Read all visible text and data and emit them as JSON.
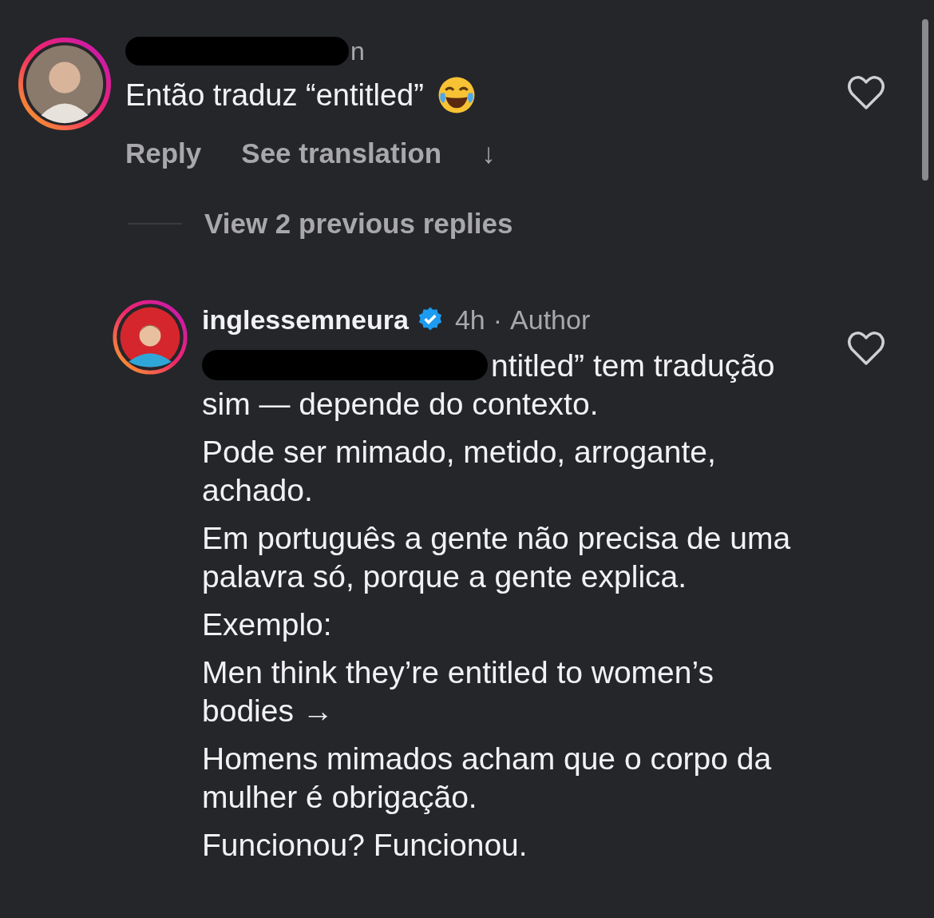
{
  "comment": {
    "username": "n",
    "redacted_username": true,
    "text": "Então traduz “entitled”",
    "liked": false,
    "actions": [
      "Reply",
      "See translation",
      "↓"
    ]
  },
  "view_replies": "View 2 previous replies",
  "reply": {
    "username": "inglessemneura",
    "verified": true,
    "time": "4h",
    "separator": "·",
    "badge": "Author",
    "liked": false,
    "redacted_start": true,
    "paragraphs": [
      "ntitled” tem tradução sim — depende do contexto.",
      "Pode ser mimado, metido, arrogante, achado.",
      "Em português a gente não precisa de uma palavra só, porque a gente explica.",
      "Exemplo:",
      "Men think they’re entitled to women’s bodies →",
      "Homens mimados acham que o corpo da mulher é obrigação.",
      "Funcionou? Funcionou."
    ]
  }
}
